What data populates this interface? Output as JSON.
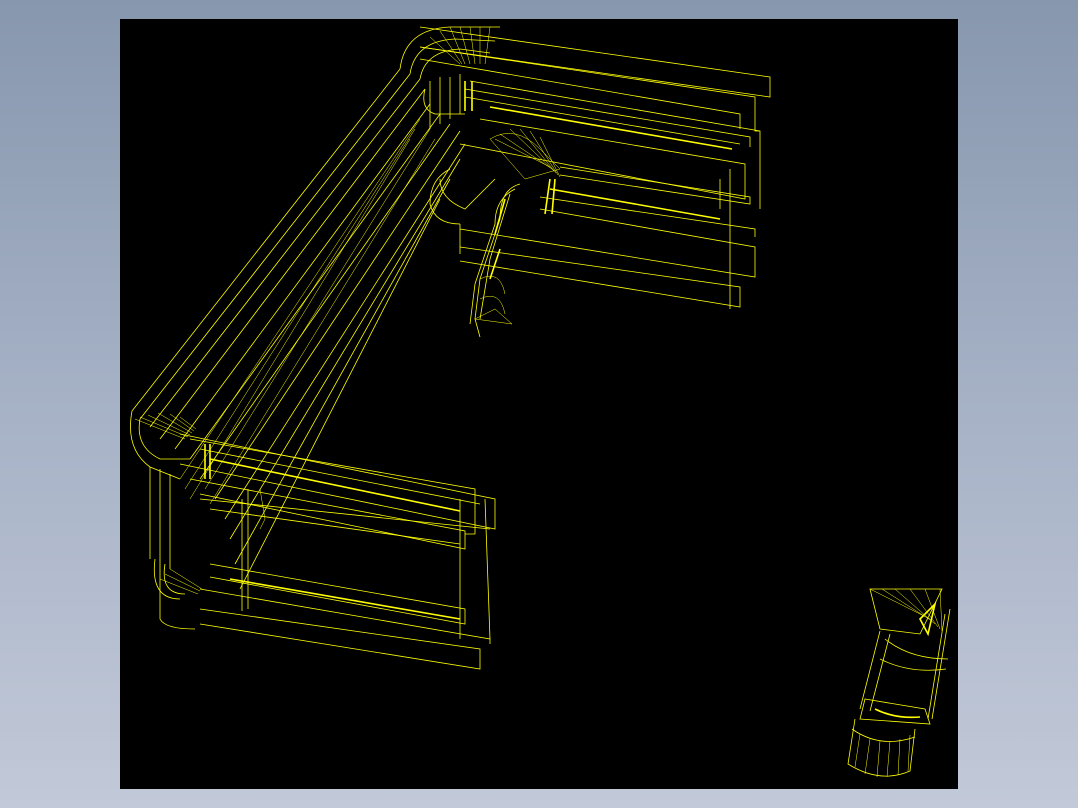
{
  "canvas": {
    "background_gradient": [
      "#8797ae",
      "#c2c9d8"
    ],
    "viewport_color": "#000000",
    "wire_color": "#ffff00"
  },
  "model": {
    "style": "wireframe",
    "parts": [
      {
        "name": "corner-frame-profile",
        "icon": "frame-icon"
      },
      {
        "name": "cylindrical-pin-part",
        "icon": "cylinder-icon"
      }
    ]
  }
}
